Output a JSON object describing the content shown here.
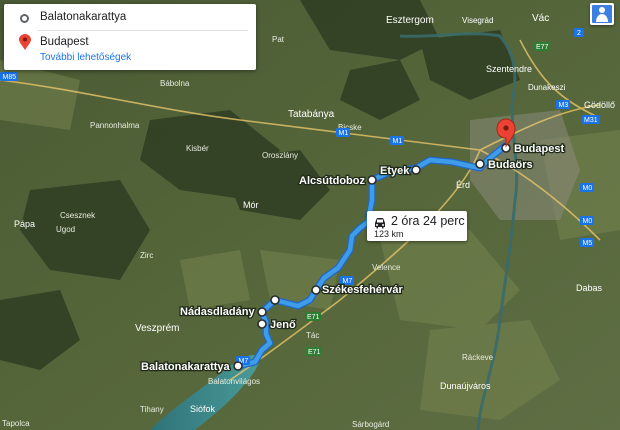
{
  "directions": {
    "origin": "Balatonakarattya",
    "destination": "Budapest",
    "more_options": "További lehetőségek"
  },
  "route_summary": {
    "duration": "2 óra 24 perc",
    "distance": "123 km"
  },
  "waypoints": [
    {
      "name": "Budapest"
    },
    {
      "name": "Budaörs"
    },
    {
      "name": "Etyek"
    },
    {
      "name": "Alcsútdoboz"
    },
    {
      "name": "Székesfehérvár"
    },
    {
      "name": "Nádasdladány"
    },
    {
      "name": "Jenő"
    },
    {
      "name": "Balatonakarattya"
    }
  ],
  "places": [
    {
      "name": "Esztergom",
      "size": 10
    },
    {
      "name": "Visegrád",
      "size": 8
    },
    {
      "name": "Vác",
      "size": 10
    },
    {
      "name": "Szentendre",
      "size": 9
    },
    {
      "name": "Dunakeszi",
      "size": 8
    },
    {
      "name": "Gödöllő",
      "size": 9
    },
    {
      "name": "Bábolna",
      "size": 8
    },
    {
      "name": "Pannonhalma",
      "size": 8
    },
    {
      "name": "Tatabánya",
      "size": 10
    },
    {
      "name": "Kisbér",
      "size": 8
    },
    {
      "name": "Oroszlány",
      "size": 8
    },
    {
      "name": "Bicske",
      "size": 8
    },
    {
      "name": "Csesznek",
      "size": 8
    },
    {
      "name": "Pápa",
      "size": 9
    },
    {
      "name": "Ugod",
      "size": 8
    },
    {
      "name": "Mór",
      "size": 9
    },
    {
      "name": "Zirc",
      "size": 8
    },
    {
      "name": "Érd",
      "size": 9
    },
    {
      "name": "Velence",
      "size": 8
    },
    {
      "name": "Dabas",
      "size": 9
    },
    {
      "name": "Veszprém",
      "size": 10
    },
    {
      "name": "Tác",
      "size": 8
    },
    {
      "name": "Balatonvilágos",
      "size": 8
    },
    {
      "name": "Siófok",
      "size": 9
    },
    {
      "name": "Tihany",
      "size": 8
    },
    {
      "name": "Tapolca",
      "size": 8
    },
    {
      "name": "Ráckeve",
      "size": 8
    },
    {
      "name": "Dunaújváros",
      "size": 9
    },
    {
      "name": "Sárbogárd",
      "size": 8
    },
    {
      "name": "Pat",
      "size": 8
    }
  ],
  "road_shields": [
    "M85",
    "M1",
    "M1",
    "M0",
    "M0",
    "M3",
    "M31",
    "M5",
    "M7",
    "M7",
    "E71",
    "E71",
    "E77",
    "2"
  ],
  "colors": {
    "route": "#3f9ce8",
    "route_outline": "#1f68c4",
    "destination_pin": "#ea4335",
    "link": "#1a73e8",
    "motorway_shield": "#1a73e8",
    "european_route_shield": "#2e7d32",
    "lake": "#3d8a8c"
  }
}
